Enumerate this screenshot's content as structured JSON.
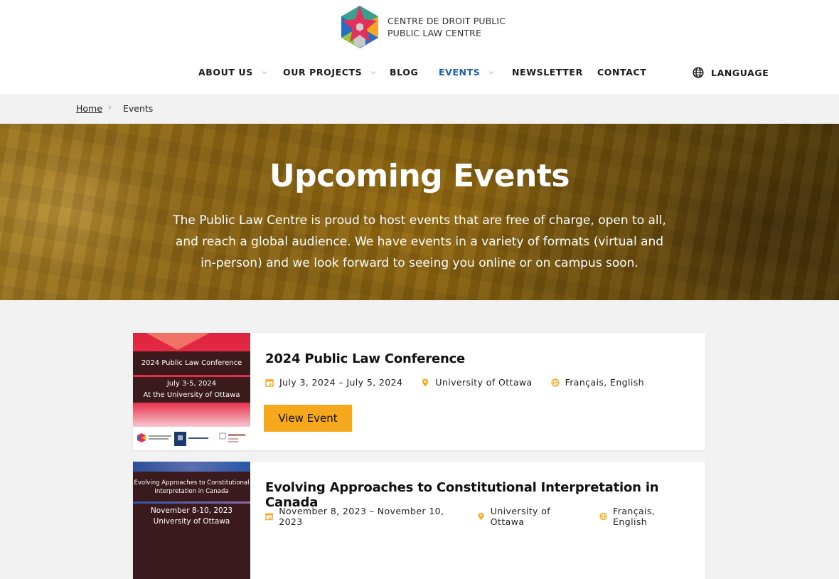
{
  "header": {
    "logo": {
      "line1": "CENTRE DE DROIT PUBLIC",
      "line2": "PUBLIC LAW CENTRE"
    },
    "nav": [
      {
        "label": "ABOUT US",
        "has_dropdown": true,
        "active": false
      },
      {
        "label": "OUR PROJECTS",
        "has_dropdown": true,
        "active": false
      },
      {
        "label": "BLOG",
        "has_dropdown": false,
        "active": false
      },
      {
        "label": "EVENTS",
        "has_dropdown": true,
        "active": true
      },
      {
        "label": "NEWSLETTER",
        "has_dropdown": false,
        "active": false
      },
      {
        "label": "CONTACT",
        "has_dropdown": false,
        "active": false
      }
    ],
    "language": {
      "label": "LANGUAGE",
      "icon": "globe-icon"
    }
  },
  "breadcrumb": {
    "home": "Home",
    "separator": "›",
    "current": "Events"
  },
  "hero": {
    "title": "Upcoming Events",
    "description": "The Public Law Centre is proud to host events that are free of charge, open to all, and reach a global audience. We have events in a variety of formats (virtual and in-person) and we look forward to seeing you online or on campus soon."
  },
  "events": [
    {
      "title": "2024 Public Law Conference",
      "dates": "July 3, 2024 – July 5, 2024",
      "location": "University of Ottawa",
      "languages": "Français, English",
      "button_label": "View Event",
      "image": {
        "line1": "2024 Public Law Conference",
        "line2": "July 3-5, 2024",
        "line3": "At the University of Ottawa"
      }
    },
    {
      "title": "Evolving Approaches to Constitutional Interpretation in Canada",
      "dates": "November 8, 2023 – November 10, 2023",
      "location": "University of Ottawa",
      "languages": "Français, English",
      "image": {
        "line1": "Evolving Approaches to Constitutional Interpretation in Canada",
        "line2": "November 8-10, 2023",
        "line3": "University of Ottawa"
      }
    }
  ],
  "colors": {
    "accent_blue": "#1a5fb4",
    "button_orange": "#f5a81c",
    "icon_orange": "#f5a81c"
  }
}
